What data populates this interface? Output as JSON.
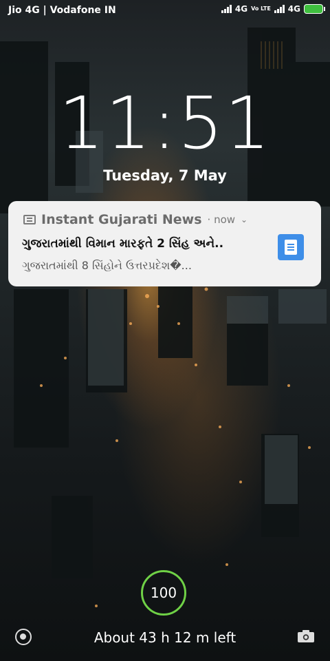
{
  "status_bar": {
    "carrier": "Jio 4G | Vodafone IN",
    "network_1": "4G",
    "volte": "Vo LTE",
    "network_2": "4G",
    "icons": [
      "signal-icon",
      "signal-icon",
      "battery-charging-icon"
    ]
  },
  "lockscreen": {
    "time": "11:51",
    "date": "Tuesday, 7 May"
  },
  "notification": {
    "app_name": "Instant Gujarati News",
    "time": "· now",
    "chevron": "⌄",
    "title": "ગુજરાતમાંથી વિમાન મારફતે 2 સિંહ અને..",
    "body": "ગુજરાતમાંથી 8 સિંહોને ઉત્તરપ્રદેશ�...",
    "icon": "news-app-icon",
    "thumbnail_color": "#3e8ee8"
  },
  "charging": {
    "level": "100",
    "time_left": "About 43 h 12 m left",
    "ring_color": "#6fd146"
  },
  "bottom": {
    "left_icon": "assistant-icon",
    "right_icon": "camera-icon"
  }
}
